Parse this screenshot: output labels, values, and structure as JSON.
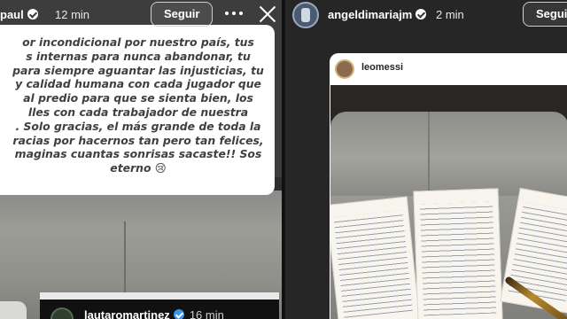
{
  "left_story": {
    "username": "paul",
    "time": "12 min",
    "follow_label": "Seguir",
    "caption_lines": [
      "or incondicional por nuestro país, tus",
      "s internas para nunca abandonar, tu",
      "para siempre aguantar las injusticias, tu",
      "y calidad humana con cada jugador que",
      "al predio para que se sienta bien, los",
      "lles con cada trabajador de nuestra",
      ". Solo gracias, el más grande de toda la",
      "racias por hacernos tan pero tan felices,",
      "maginas cuantas sonrisas sacaste!! Sos",
      "eterno 😢"
    ],
    "shared_card": {
      "username": "lautaromartinez",
      "time": "16 min"
    }
  },
  "right_story": {
    "username": "angeldimariajm",
    "time": "2 min",
    "follow_label": "Seguir",
    "post": {
      "username": "leomessi"
    }
  },
  "icons": {
    "more": "more-horizontal-icon",
    "close": "close-icon",
    "verified": "verified-badge-icon"
  },
  "colors": {
    "verified_blue": "#3797f0",
    "background": "#1a1a1a"
  }
}
